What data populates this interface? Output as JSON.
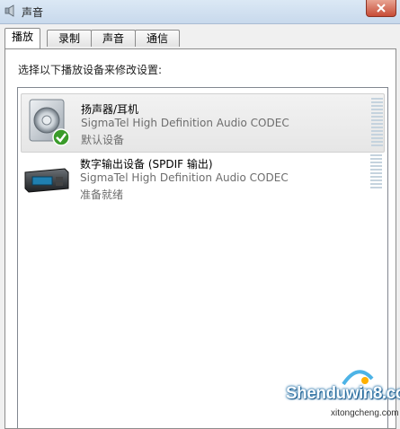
{
  "window": {
    "title": "声音"
  },
  "tabs": [
    {
      "label": "播放",
      "active": true
    },
    {
      "label": "录制",
      "active": false
    },
    {
      "label": "声音",
      "active": false
    },
    {
      "label": "通信",
      "active": false
    }
  ],
  "instruction": "选择以下播放设备来修改设置:",
  "devices": [
    {
      "name": "扬声器/耳机",
      "description": "SigmaTel High Definition Audio CODEC",
      "status": "默认设备",
      "icon": "speaker-icon",
      "default": true,
      "selected": true
    },
    {
      "name": "数字输出设备 (SPDIF 输出)",
      "description": "SigmaTel High Definition Audio CODEC",
      "status": "准备就绪",
      "icon": "digital-output-icon",
      "default": false,
      "selected": false
    }
  ],
  "watermark": {
    "text": "Shenduwin8.com",
    "sub": "xitongcheng.com"
  },
  "colors": {
    "accent_check": "#3a9b2a",
    "meter": "#c5d3de",
    "status_text": "#6d6d6d"
  }
}
